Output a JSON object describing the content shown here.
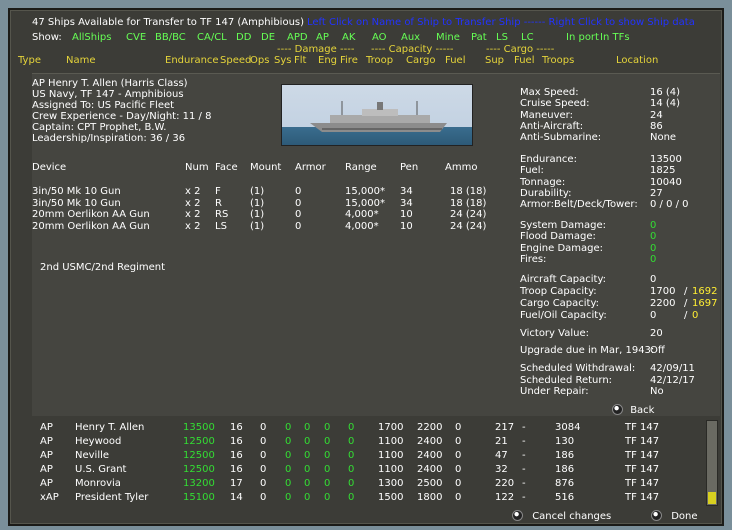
{
  "header": {
    "title": "47 Ships Available for Transfer to TF 147 (Amphibious)",
    "hint": "Left Click on Name of Ship to Transfer Ship  ------  Right Click to show Ship data"
  },
  "show_label": "Show:",
  "filters": [
    "AllShips",
    "CVE",
    "BB/BC",
    "CA/CL",
    "DD",
    "DE",
    "APD",
    "AP",
    "AK",
    "AO",
    "Aux",
    "Mine",
    "Pat",
    "LS",
    "LC",
    "In port",
    "In TFs"
  ],
  "group_headers": {
    "damage": "---- Damage ----",
    "capacity": "---- Capacity -----",
    "cargo": "---- Cargo -----"
  },
  "columns": [
    "Type",
    "Name",
    "Endurance",
    "Speed",
    "Ops",
    "Sys",
    "Flt",
    "Eng",
    "Fire",
    "Troop",
    "Cargo",
    "Fuel",
    "Sup",
    "Fuel",
    "Troops",
    "Location"
  ],
  "ship": {
    "name_line": "AP Henry T. Allen (Harris Class)",
    "navy_line": "US Navy, TF 147 - Amphibious",
    "assigned": "Assigned To:    US Pacific Fleet",
    "crew": "Crew Experience - Day/Night:  11  /  8",
    "captain": "Captain:  CPT Prophet, B.W.",
    "leadership": "Leadership/Inspiration: 36 / 36"
  },
  "device_headers": {
    "device": "Device",
    "num": "Num",
    "face": "Face",
    "mount": "Mount",
    "armor": "Armor",
    "range": "Range",
    "pen": "Pen",
    "ammo": "Ammo"
  },
  "devices": [
    {
      "device": "3in/50 Mk 10 Gun",
      "num": "x 2",
      "face": "F",
      "mount": "(1)",
      "armor": "0",
      "range": "15,000*",
      "pen": "34",
      "ammo": "18  (18)"
    },
    {
      "device": "3in/50 Mk 10 Gun",
      "num": "x 2",
      "face": "R",
      "mount": "(1)",
      "armor": "0",
      "range": "15,000*",
      "pen": "34",
      "ammo": "18  (18)"
    },
    {
      "device": "20mm Oerlikon AA Gun",
      "num": "x 2",
      "face": "RS",
      "mount": "(1)",
      "armor": "0",
      "range": "4,000*",
      "pen": "10",
      "ammo": "24  (24)"
    },
    {
      "device": "20mm Oerlikon AA Gun",
      "num": "x 2",
      "face": "LS",
      "mount": "(1)",
      "armor": "0",
      "range": "4,000*",
      "pen": "10",
      "ammo": "24  (24)"
    }
  ],
  "embarked": "2nd USMC/2nd Regiment",
  "stats": [
    {
      "label": "Max Speed:",
      "value": "16  (4)"
    },
    {
      "label": "Cruise Speed:",
      "value": "14  (4)"
    },
    {
      "label": "Maneuver:",
      "value": "24"
    },
    {
      "label": "Anti-Aircraft:",
      "value": "86"
    },
    {
      "label": "Anti-Submarine:",
      "value": "None"
    }
  ],
  "stats2": [
    {
      "label": "Endurance:",
      "value": "13500"
    },
    {
      "label": "Fuel:",
      "value": "1825"
    },
    {
      "label": "Tonnage:",
      "value": "10040"
    },
    {
      "label": "Durability:",
      "value": "27"
    },
    {
      "label": "Armor:Belt/Deck/Tower:",
      "value": "0 / 0 / 0"
    }
  ],
  "damage": [
    {
      "label": "System Damage:",
      "value": "0"
    },
    {
      "label": "Flood Damage:",
      "value": "0"
    },
    {
      "label": "Engine Damage:",
      "value": "0"
    },
    {
      "label": "Fires:",
      "value": "0"
    }
  ],
  "capacity": {
    "aircraft_label": "Aircraft Capacity:",
    "aircraft_value": "0",
    "troop_label": "Troop Capacity:",
    "troop_value": "1700",
    "troop_avail": "1692",
    "cargo_label": "Cargo Capacity:",
    "cargo_value": "2200",
    "cargo_avail": "1697",
    "fuel_label": "Fuel/Oil Capacity:",
    "fuel_value": "0",
    "fuel_avail": "0",
    "slash": "/"
  },
  "victory": {
    "label": "Victory Value:",
    "value": "20"
  },
  "upgrade": {
    "label": "Upgrade due in Mar, 1943:",
    "value": "Off"
  },
  "schedule": [
    {
      "label": "Scheduled Withdrawal:",
      "value": "42/09/11"
    },
    {
      "label": "Scheduled Return:",
      "value": "42/12/17"
    },
    {
      "label": "Under Repair:",
      "value": "No"
    }
  ],
  "back_label": "Back",
  "rows": [
    {
      "type": "AP",
      "name": "Henry T. Allen",
      "endurance": "13500",
      "speed": "16",
      "ops": "0",
      "sys": "0",
      "flt": "0",
      "eng": "0",
      "fire": "0",
      "troop": "1700",
      "cargo": "2200",
      "fuel": "0",
      "sup": "217",
      "cfuel": "-",
      "troops": "3084",
      "location": "TF 147"
    },
    {
      "type": "AP",
      "name": "Heywood",
      "endurance": "12500",
      "speed": "16",
      "ops": "0",
      "sys": "0",
      "flt": "0",
      "eng": "0",
      "fire": "0",
      "troop": "1100",
      "cargo": "2400",
      "fuel": "0",
      "sup": "21",
      "cfuel": "-",
      "troops": "130",
      "location": "TF 147"
    },
    {
      "type": "AP",
      "name": "Neville",
      "endurance": "12500",
      "speed": "16",
      "ops": "0",
      "sys": "0",
      "flt": "0",
      "eng": "0",
      "fire": "0",
      "troop": "1100",
      "cargo": "2400",
      "fuel": "0",
      "sup": "47",
      "cfuel": "-",
      "troops": "186",
      "location": "TF 147"
    },
    {
      "type": "AP",
      "name": "U.S. Grant",
      "endurance": "12500",
      "speed": "16",
      "ops": "0",
      "sys": "0",
      "flt": "0",
      "eng": "0",
      "fire": "0",
      "troop": "1100",
      "cargo": "2400",
      "fuel": "0",
      "sup": "32",
      "cfuel": "-",
      "troops": "186",
      "location": "TF 147"
    },
    {
      "type": "AP",
      "name": "Monrovia",
      "endurance": "13200",
      "speed": "17",
      "ops": "0",
      "sys": "0",
      "flt": "0",
      "eng": "0",
      "fire": "0",
      "troop": "1300",
      "cargo": "2500",
      "fuel": "0",
      "sup": "220",
      "cfuel": "-",
      "troops": "876",
      "location": "TF 147"
    },
    {
      "type": "xAP",
      "name": "President Tyler",
      "endurance": "15100",
      "speed": "14",
      "ops": "0",
      "sys": "0",
      "flt": "0",
      "eng": "0",
      "fire": "0",
      "troop": "1500",
      "cargo": "1800",
      "fuel": "0",
      "sup": "122",
      "cfuel": "-",
      "troops": "516",
      "location": "TF 147"
    }
  ],
  "footer": {
    "cancel_label": "Cancel changes",
    "done_label": "Done"
  }
}
